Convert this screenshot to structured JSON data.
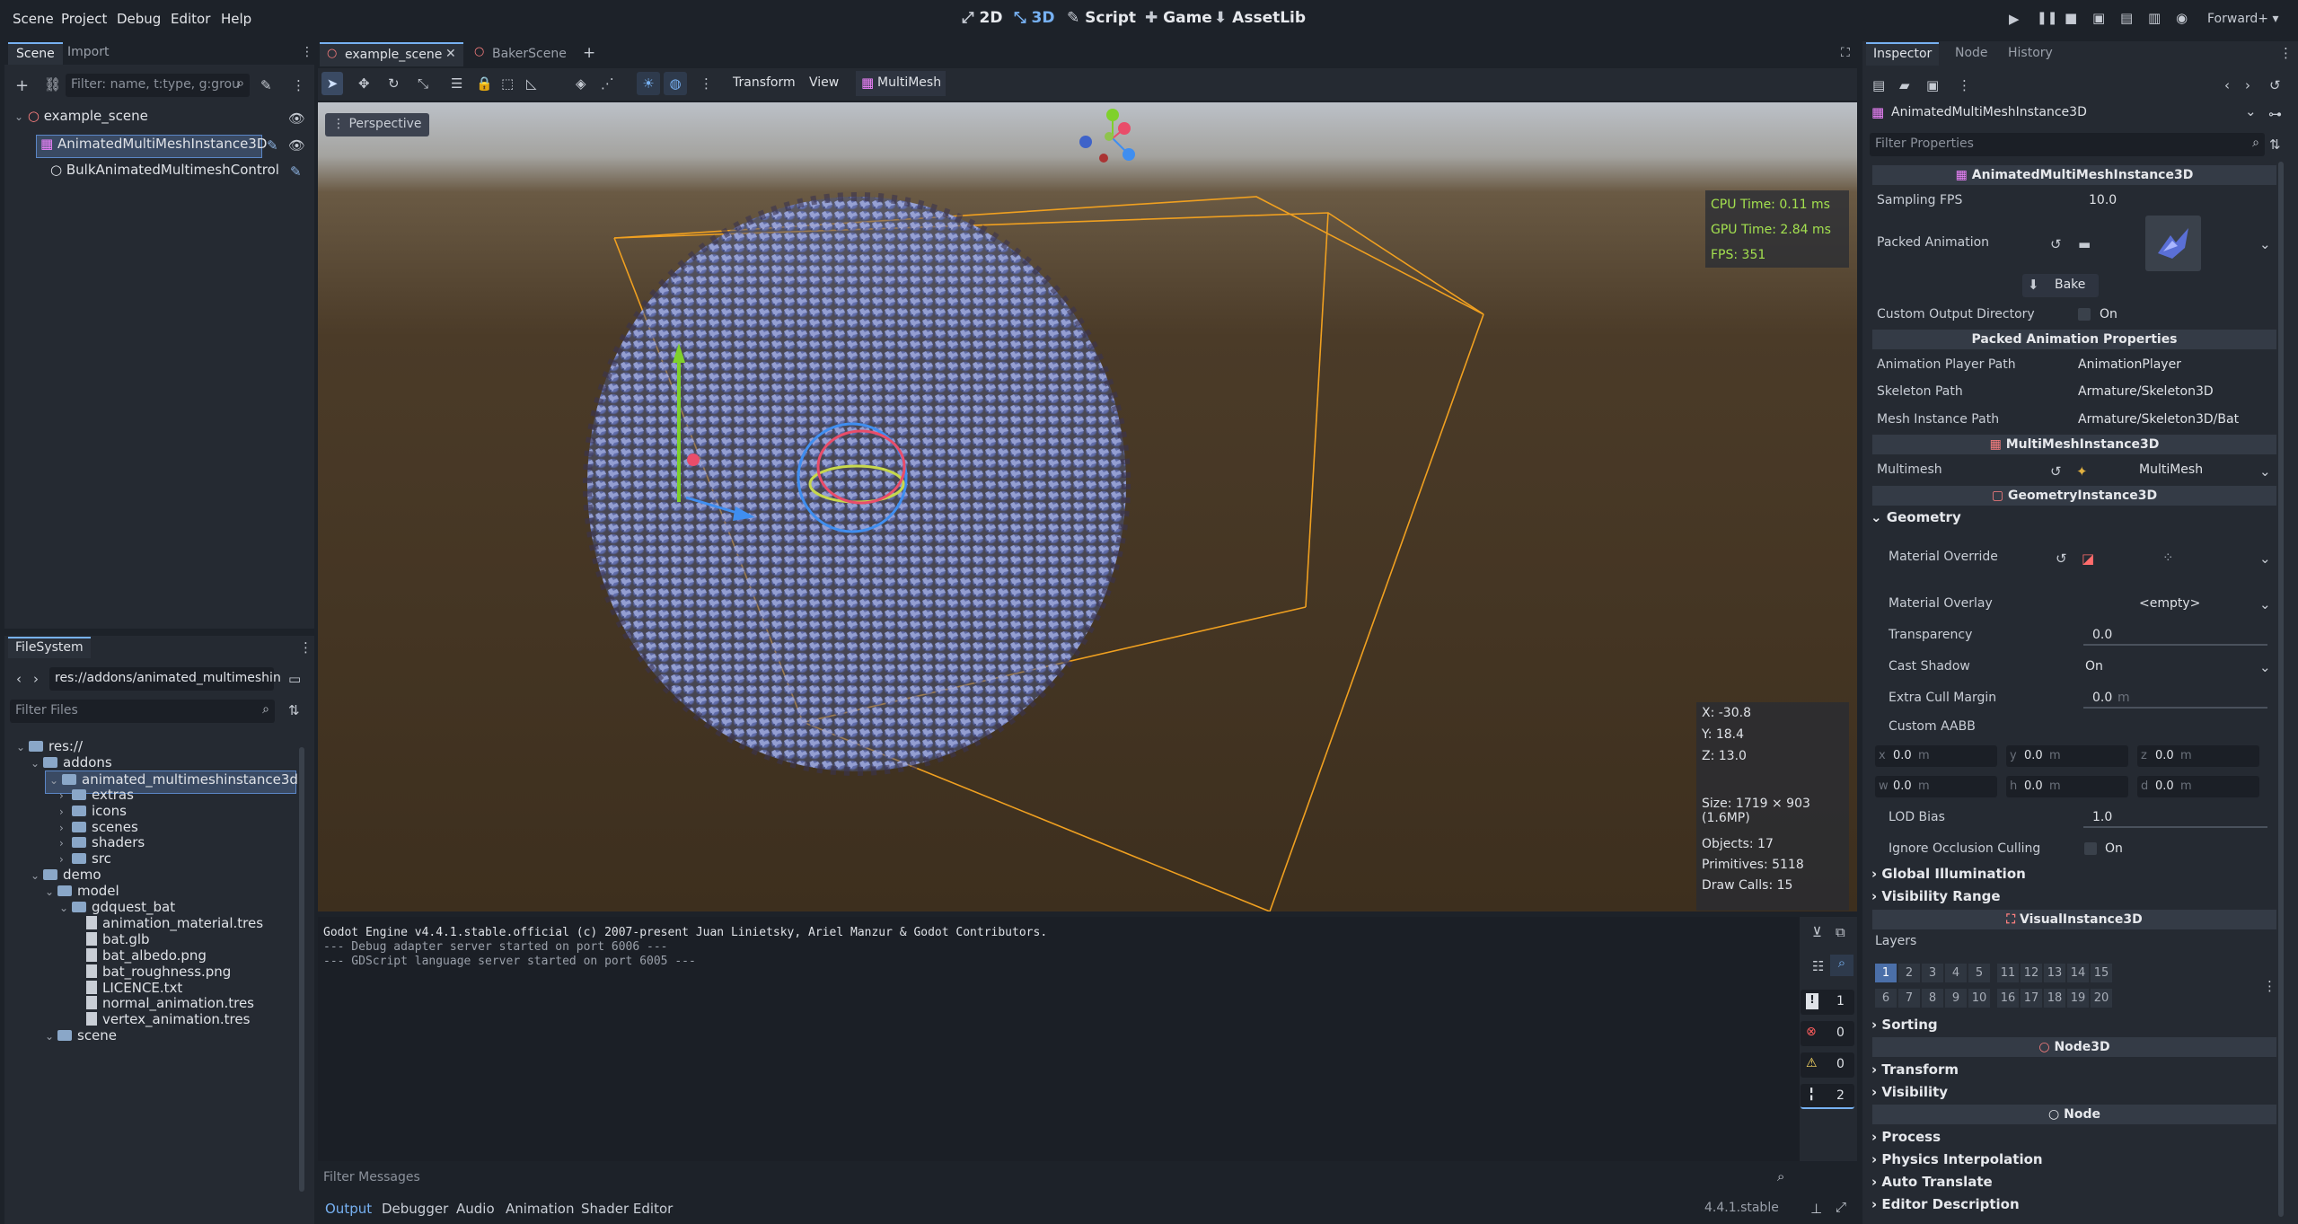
{
  "menu": [
    "Scene",
    "Project",
    "Debug",
    "Editor",
    "Help"
  ],
  "workspaces": [
    {
      "label": "2D",
      "icon": "2d-icon"
    },
    {
      "label": "3D",
      "icon": "3d-icon",
      "active": true
    },
    {
      "label": "Script",
      "icon": "script-icon"
    },
    {
      "label": "Game",
      "icon": "game-icon"
    },
    {
      "label": "AssetLib",
      "icon": "assetlib-icon"
    }
  ],
  "renderer": "Forward+",
  "scene_dock": {
    "tabs": [
      "Scene",
      "Import"
    ],
    "filter_placeholder": "Filter: name, t:type, g:grou",
    "tree": [
      "example_scene",
      "AnimatedMultiMeshInstance3D",
      "BulkAnimatedMultimeshControl"
    ]
  },
  "filesystem": {
    "title": "FileSystem",
    "path": "res://addons/animated_multimeshin",
    "filter_placeholder": "Filter Files",
    "items": [
      {
        "label": "res://",
        "type": "folder"
      },
      {
        "label": "addons",
        "type": "folder"
      },
      {
        "label": "animated_multimeshinstance3d",
        "type": "folder"
      },
      {
        "label": "extras",
        "type": "folder"
      },
      {
        "label": "icons",
        "type": "folder"
      },
      {
        "label": "scenes",
        "type": "folder"
      },
      {
        "label": "shaders",
        "type": "folder"
      },
      {
        "label": "src",
        "type": "folder"
      },
      {
        "label": "demo",
        "type": "folder"
      },
      {
        "label": "model",
        "type": "folder"
      },
      {
        "label": "gdquest_bat",
        "type": "folder"
      },
      {
        "label": "animation_material.tres",
        "type": "file"
      },
      {
        "label": "bat.glb",
        "type": "file"
      },
      {
        "label": "bat_albedo.png",
        "type": "file"
      },
      {
        "label": "bat_roughness.png",
        "type": "file"
      },
      {
        "label": "LICENCE.txt",
        "type": "file"
      },
      {
        "label": "normal_animation.tres",
        "type": "file"
      },
      {
        "label": "vertex_animation.tres",
        "type": "file"
      },
      {
        "label": "scene",
        "type": "folder"
      }
    ]
  },
  "editor_tabs": [
    "example_scene",
    "BakerScene"
  ],
  "toolbar_menus": [
    "Transform",
    "View",
    "MultiMesh"
  ],
  "viewport": {
    "perspective": "Perspective",
    "cpu_time": "CPU Time: 0.11 ms",
    "gpu_time": "GPU Time: 2.84 ms",
    "fps": "FPS: 351",
    "x": "X: -30.8",
    "y": "Y: 18.4",
    "z": "Z: 13.0",
    "size": "Size: 1719 × 903 (1.6MP)",
    "objects": "Objects: 17",
    "primitives": "Primitives: 5118",
    "draw_calls": "Draw Calls: 15"
  },
  "output": {
    "lines": [
      "Godot Engine v4.4.1.stable.official (c) 2007-present Juan Linietsky, Ariel Manzur & Godot Contributors.",
      "--- Debug adapter server started on port 6006 ---",
      "--- GDScript language server started on port 6005 ---"
    ],
    "filter_placeholder": "Filter Messages",
    "counts": [
      "1",
      "0",
      "0",
      "2"
    ],
    "tabs": [
      "Output",
      "Debugger",
      "Audio",
      "Animation",
      "Shader Editor"
    ],
    "version": "4.4.1.stable"
  },
  "inspector": {
    "tabs": [
      "Inspector",
      "Node",
      "History"
    ],
    "node_name": "AnimatedMultiMeshInstance3D",
    "filter_placeholder": "Filter Properties",
    "sections": {
      "amm": "AnimatedMultiMeshInstance3D",
      "packed": "Packed Animation Properties",
      "multimesh": "MultiMeshInstance3D",
      "geometry": "GeometryInstance3D",
      "visual": "VisualInstance3D",
      "node3d": "Node3D",
      "node": "Node"
    },
    "props": {
      "sampling_fps": "Sampling FPS",
      "sampling_fps_val": "10.0",
      "packed_animation": "Packed Animation",
      "bake": "Bake",
      "custom_output_dir": "Custom Output Directory",
      "on": "On",
      "anim_player_path": "Animation Player Path",
      "anim_player_val": "AnimationPlayer",
      "skeleton_path": "Skeleton Path",
      "skeleton_val": "Armature/Skeleton3D",
      "mesh_path": "Mesh Instance Path",
      "mesh_val": "Armature/Skeleton3D/Bat",
      "multimesh": "Multimesh",
      "multimesh_val": "MultiMesh",
      "geometry": "Geometry",
      "material_override": "Material Override",
      "material_overlay": "Material Overlay",
      "empty": "<empty>",
      "transparency": "Transparency",
      "transparency_val": "0.0",
      "cast_shadow": "Cast Shadow",
      "cast_shadow_val": "On",
      "extra_cull": "Extra Cull Margin",
      "extra_cull_val": "0.0",
      "unit_m": "m",
      "custom_aabb": "Custom AABB",
      "aabb": [
        {
          "axis": "x",
          "val": "0.0"
        },
        {
          "axis": "y",
          "val": "0.0"
        },
        {
          "axis": "z",
          "val": "0.0"
        },
        {
          "axis": "w",
          "val": "0.0"
        },
        {
          "axis": "h",
          "val": "0.0"
        },
        {
          "axis": "d",
          "val": "0.0"
        }
      ],
      "lod_bias": "LOD Bias",
      "lod_bias_val": "1.0",
      "ignore_occlusion": "Ignore Occlusion Culling",
      "global_illumination": "Global Illumination",
      "visibility_range": "Visibility Range",
      "layers": "Layers",
      "layer_numbers": [
        "1",
        "2",
        "3",
        "4",
        "5",
        "11",
        "12",
        "13",
        "14",
        "15",
        "6",
        "7",
        "8",
        "9",
        "10",
        "16",
        "17",
        "18",
        "19",
        "20"
      ],
      "sorting": "Sorting",
      "transform": "Transform",
      "visibility": "Visibility",
      "process": "Process",
      "physics_interp": "Physics Interpolation",
      "auto_translate": "Auto Translate",
      "editor_description": "Editor Description"
    }
  },
  "colors": {
    "accent": "#77b1f2",
    "aabb": "#f0a020",
    "bats": "#6f7ec4"
  }
}
